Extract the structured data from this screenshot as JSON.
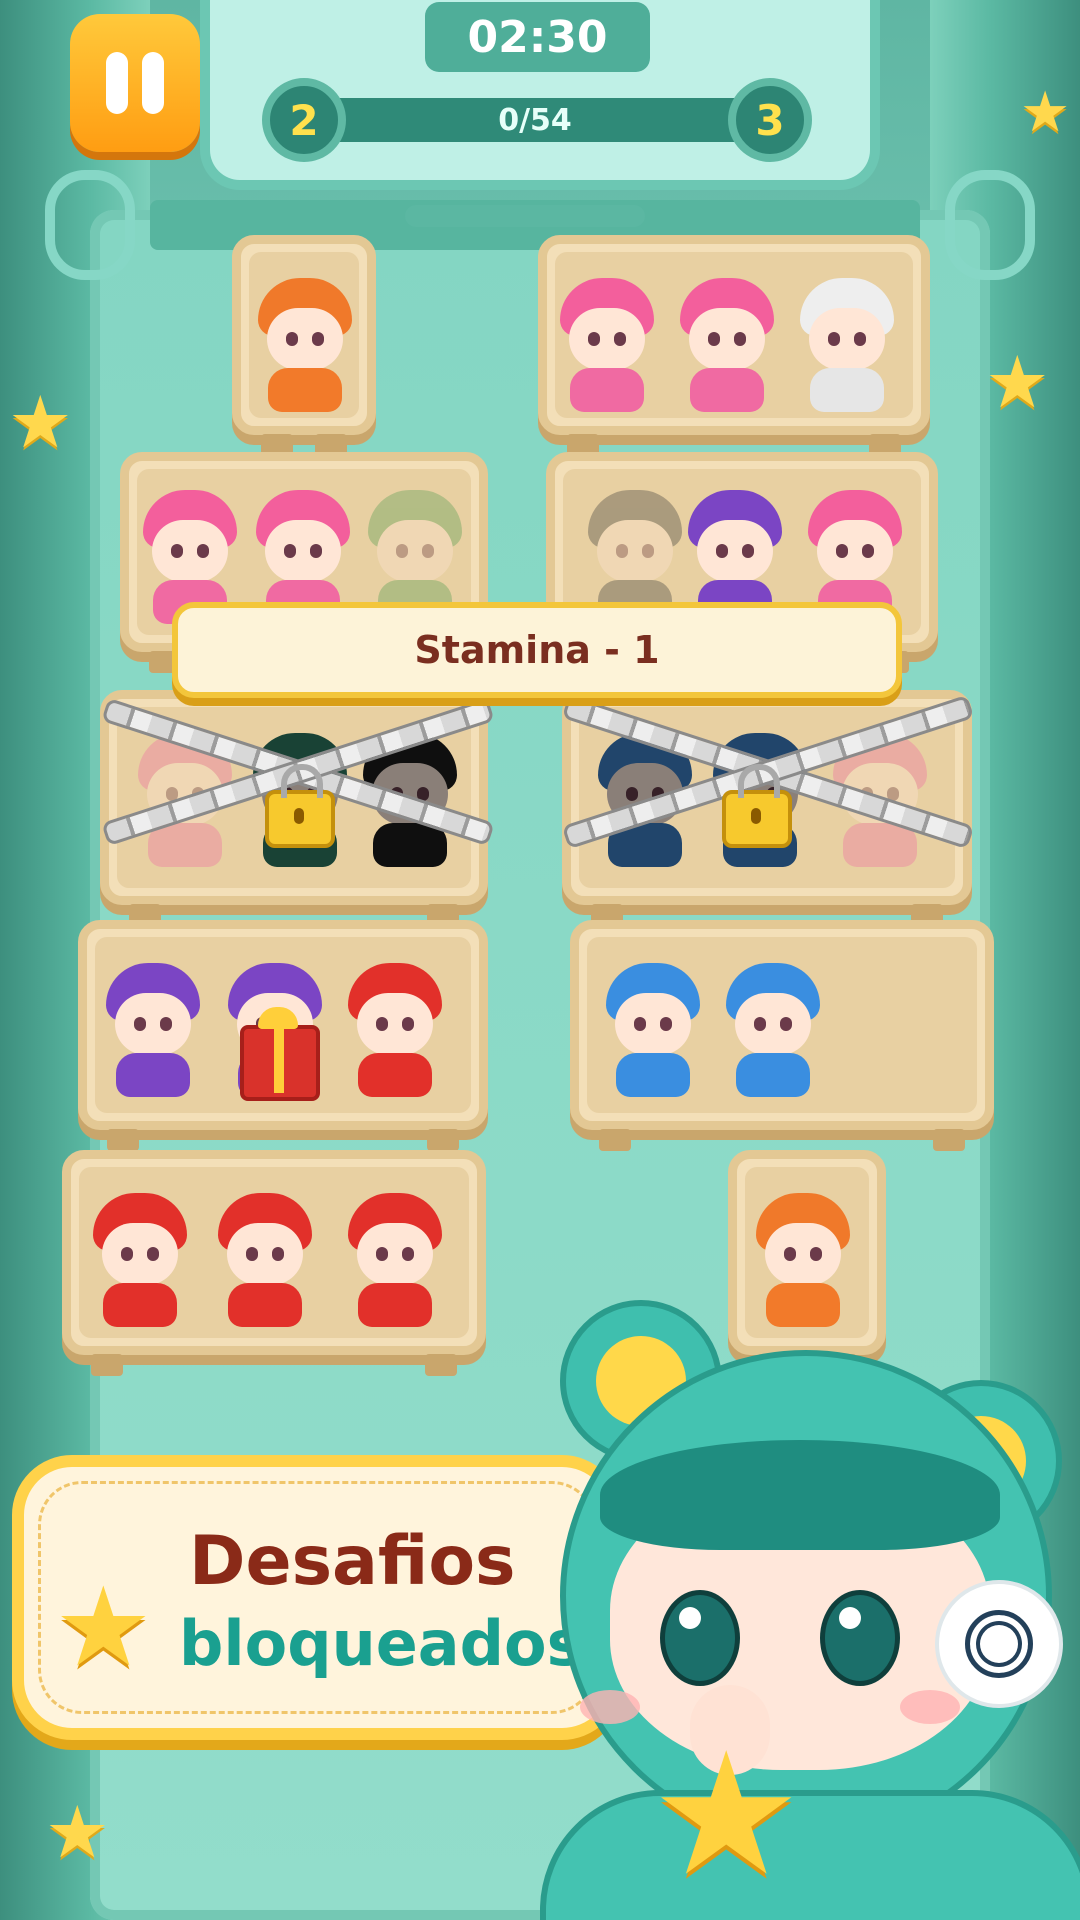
{
  "hud": {
    "timer": "02:30",
    "level_current": "2",
    "level_next": "3",
    "progress_text": "0/54",
    "progress_fraction": 0.03
  },
  "toast": {
    "text": "Stamina - 1"
  },
  "banner": {
    "line1": "Desafios",
    "line2": "bloqueados"
  },
  "colors": {
    "accent_yellow": "#ffd24a",
    "board_teal": "#84d6c3",
    "banner_red_text": "#8a2a18",
    "banner_teal_text": "#1aa090",
    "toast_text": "#7a2e20"
  },
  "shelves": [
    {
      "id": "shelf-1",
      "slots": [
        "orange-hat"
      ],
      "locked": false
    },
    {
      "id": "shelf-2",
      "slots": [
        "pink",
        "pink",
        "white-glasses"
      ],
      "locked": false
    },
    {
      "id": "shelf-3",
      "slots": [
        "pink",
        "pink",
        "green-faded"
      ],
      "locked": false
    },
    {
      "id": "shelf-4",
      "slots": [
        "dark-faded",
        "purple",
        "pink"
      ],
      "locked": false
    },
    {
      "id": "shelf-5",
      "slots": [
        "faded",
        "green-dark",
        "black-hat"
      ],
      "locked": true
    },
    {
      "id": "shelf-6",
      "slots": [
        "blue",
        "blue",
        "faded"
      ],
      "locked": true
    },
    {
      "id": "shelf-7",
      "slots": [
        "purple",
        "purple-gift",
        "red"
      ],
      "locked": false
    },
    {
      "id": "shelf-8",
      "slots": [
        "blue",
        "blue",
        "empty"
      ],
      "locked": false
    },
    {
      "id": "shelf-9",
      "slots": [
        "red",
        "red",
        "red"
      ],
      "locked": false
    },
    {
      "id": "shelf-10",
      "slots": [
        "orange-hat"
      ],
      "locked": false
    }
  ],
  "icons": {
    "pause": "pause-icon",
    "lock": "padlock-icon",
    "gift": "gift-box-icon",
    "star": "star-icon",
    "thought": "scribble-thought-icon"
  }
}
